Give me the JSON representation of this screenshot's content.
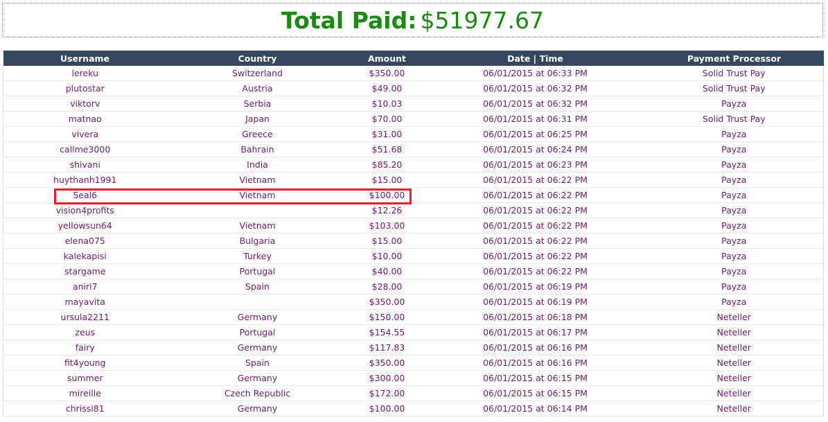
{
  "total": {
    "label": "Total Paid:",
    "value": "$51977.67"
  },
  "table": {
    "headers": [
      "Username",
      "Country",
      "Amount",
      "Date | Time",
      "Payment Processor"
    ],
    "rows": [
      [
        "lereku",
        "Switzerland",
        "$350.00",
        "06/01/2015 at 06:33 PM",
        "Solid Trust Pay"
      ],
      [
        "plutostar",
        "Austria",
        "$49.00",
        "06/01/2015 at 06:32 PM",
        "Solid Trust Pay"
      ],
      [
        "viktorv",
        "Serbia",
        "$10.03",
        "06/01/2015 at 06:32 PM",
        "Payza"
      ],
      [
        "matnao",
        "Japan",
        "$70.00",
        "06/01/2015 at 06:31 PM",
        "Solid Trust Pay"
      ],
      [
        "vivera",
        "Greece",
        "$31.00",
        "06/01/2015 at 06:25 PM",
        "Payza"
      ],
      [
        "callme3000",
        "Bahrain",
        "$51.68",
        "06/01/2015 at 06:24 PM",
        "Payza"
      ],
      [
        "shivani",
        "India",
        "$85.20",
        "06/01/2015 at 06:23 PM",
        "Payza"
      ],
      [
        "huythanh1991",
        "Vietnam",
        "$15.00",
        "06/01/2015 at 06:22 PM",
        "Payza"
      ],
      [
        "Seal6",
        "Vietnam",
        "$100.00",
        "06/01/2015 at 06:22 PM",
        "Payza"
      ],
      [
        "vision4profits",
        "",
        "$12.26",
        "06/01/2015 at 06:22 PM",
        "Payza"
      ],
      [
        "yellowsun64",
        "Vietnam",
        "$103.00",
        "06/01/2015 at 06:22 PM",
        "Payza"
      ],
      [
        "elena075",
        "Bulgaria",
        "$15.00",
        "06/01/2015 at 06:22 PM",
        "Payza"
      ],
      [
        "kalekapisi",
        "Turkey",
        "$10.00",
        "06/01/2015 at 06:22 PM",
        "Payza"
      ],
      [
        "stargame",
        "Portugal",
        "$40.00",
        "06/01/2015 at 06:22 PM",
        "Payza"
      ],
      [
        "aniri7",
        "Spain",
        "$28.00",
        "06/01/2015 at 06:19 PM",
        "Payza"
      ],
      [
        "mayavita",
        "",
        "$350.00",
        "06/01/2015 at 06:19 PM",
        "Payza"
      ],
      [
        "ursula2211",
        "Germany",
        "$150.00",
        "06/01/2015 at 06:18 PM",
        "Neteller"
      ],
      [
        "zeus",
        "Portugal",
        "$154.55",
        "06/01/2015 at 06:17 PM",
        "Neteller"
      ],
      [
        "fairy",
        "Germany",
        "$117.83",
        "06/01/2015 at 06:16 PM",
        "Neteller"
      ],
      [
        "fit4young",
        "Spain",
        "$350.00",
        "06/01/2015 at 06:16 PM",
        "Neteller"
      ],
      [
        "summer",
        "Germany",
        "$300.00",
        "06/01/2015 at 06:15 PM",
        "Neteller"
      ],
      [
        "mireille",
        "Czech Republic",
        "$172.00",
        "06/01/2015 at 06:15 PM",
        "Neteller"
      ],
      [
        "chrissi81",
        "Germany",
        "$100.00",
        "06/01/2015 at 06:14 PM",
        "Neteller"
      ]
    ]
  },
  "colors": {
    "total_text": "#1a8a14",
    "header_bg": "#34475e",
    "header_text": "#ffffff",
    "cell_text": "#6b1d6b",
    "highlight_border": "#e3202a"
  }
}
